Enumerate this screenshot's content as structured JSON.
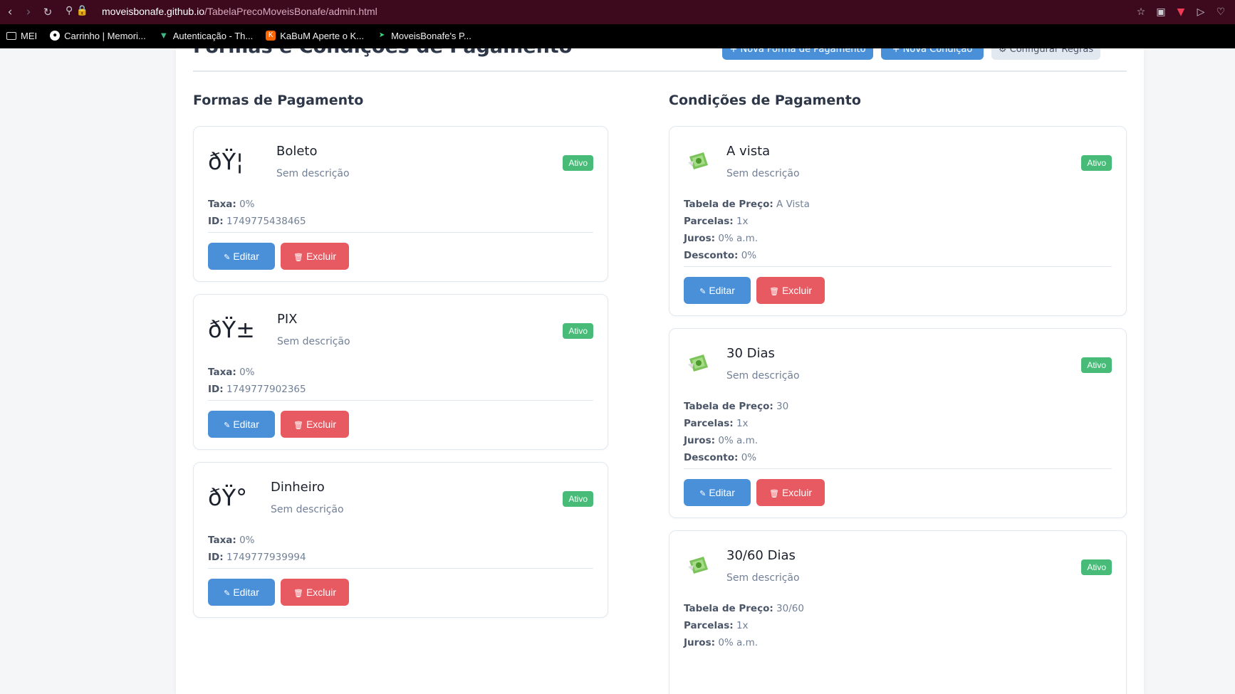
{
  "browser": {
    "url_host": "moveisbonafe.github.io",
    "url_path": "/TabelaPrecoMoveisBonafe/admin.html",
    "bookmarks": [
      {
        "label": "MEI",
        "icon": "folder-icon"
      },
      {
        "label": "Carrinho | Memori...",
        "icon": "site-icon"
      },
      {
        "label": "Autenticação - Th...",
        "icon": "vue-icon"
      },
      {
        "label": "KaBuM Aperte o K...",
        "icon": "kabum-icon"
      },
      {
        "label": "MoveisBonafe's P...",
        "icon": "bolt-icon"
      }
    ],
    "accent": "#3c0a1c"
  },
  "header": {
    "title": "Formas e Condições de Pagamento",
    "btn_new_payment": "+ Nova Forma de Pagamento",
    "btn_new_condition": "+ Nova Condição",
    "btn_rules": "⚙ Configurar Regras"
  },
  "formas": {
    "title": "Formas de Pagamento",
    "edit_label": "Editar",
    "delete_label": "Excluir",
    "taxa_label": "Taxa:",
    "id_label": "ID:",
    "items": [
      {
        "icon": "ðŸ¦",
        "name": "Boleto",
        "desc": "Sem descrição",
        "status": "Ativo",
        "taxa": "0%",
        "id": "1749775438465"
      },
      {
        "icon": "ðŸ±",
        "name": "PIX",
        "desc": "Sem descrição",
        "status": "Ativo",
        "taxa": "0%",
        "id": "1749777902365"
      },
      {
        "icon": "ðŸ°",
        "name": "Dinheiro",
        "desc": "Sem descrição",
        "status": "Ativo",
        "taxa": "0%",
        "id": "1749777939994"
      }
    ]
  },
  "condicoes": {
    "title": "Condições de Pagamento",
    "edit_label": "Editar",
    "delete_label": "Excluir",
    "tabela_label": "Tabela de Preço:",
    "parcelas_label": "Parcelas:",
    "juros_label": "Juros:",
    "desconto_label": "Desconto:",
    "items": [
      {
        "name": "A vista",
        "desc": "Sem descrição",
        "status": "Ativo",
        "tabela": "A Vista",
        "parcelas": "1x",
        "juros": "0% a.m.",
        "desconto": "0%"
      },
      {
        "name": "30 Dias",
        "desc": "Sem descrição",
        "status": "Ativo",
        "tabela": "30",
        "parcelas": "1x",
        "juros": "0% a.m.",
        "desconto": "0%"
      },
      {
        "name": "30/60 Dias",
        "desc": "Sem descrição",
        "status": "Ativo",
        "tabela": "30/60",
        "parcelas": "1x",
        "juros": "0% a.m."
      }
    ]
  },
  "colors": {
    "primary": "#4a90d9",
    "danger": "#e85a62",
    "success": "#48bb78"
  }
}
